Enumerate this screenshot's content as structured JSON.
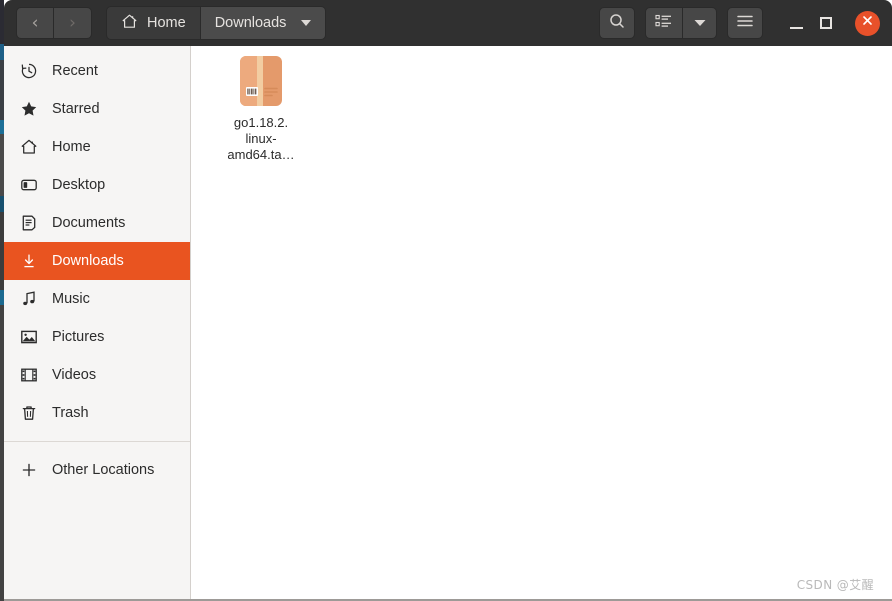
{
  "window": {
    "title": "Downloads",
    "colors": {
      "headerbar": "#303030",
      "sidebar": "#f6f5f4",
      "accent": "#e95420",
      "content": "#ffffff"
    }
  },
  "headerbar": {
    "back_button": {
      "label": "‹",
      "name": "back-button",
      "enabled": true
    },
    "forward_button": {
      "label": "›",
      "name": "forward-button",
      "enabled": false
    },
    "path": [
      {
        "label": "Home",
        "icon": "home-icon",
        "active": false
      },
      {
        "label": "Downloads",
        "icon": "chevron-down-icon",
        "active": true
      }
    ],
    "search_button": {
      "icon": "search-icon",
      "tooltip": "Search"
    },
    "view_button": {
      "icon": "list-view-icon",
      "tooltip": "View options"
    },
    "view_dropdown": {
      "icon": "chevron-down-icon"
    },
    "menu_button": {
      "icon": "hamburger-menu-icon",
      "tooltip": "Main Menu"
    },
    "window_controls": {
      "minimize": "–",
      "maximize": "□",
      "close": "✕"
    }
  },
  "sidebar": {
    "items": [
      {
        "label": "Recent",
        "icon": "clock-icon",
        "selected": false
      },
      {
        "label": "Starred",
        "icon": "star-icon",
        "selected": false
      },
      {
        "label": "Home",
        "icon": "home-icon",
        "selected": false
      },
      {
        "label": "Desktop",
        "icon": "desktop-icon",
        "selected": false
      },
      {
        "label": "Documents",
        "icon": "document-icon",
        "selected": false
      },
      {
        "label": "Downloads",
        "icon": "download-icon",
        "selected": true
      },
      {
        "label": "Music",
        "icon": "music-note-icon",
        "selected": false
      },
      {
        "label": "Pictures",
        "icon": "picture-icon",
        "selected": false
      },
      {
        "label": "Videos",
        "icon": "film-icon",
        "selected": false
      },
      {
        "label": "Trash",
        "icon": "trash-icon",
        "selected": false
      }
    ],
    "other_locations": {
      "label": "Other Locations",
      "icon": "plus-icon"
    }
  },
  "files": [
    {
      "name_line1": "go1.18.2.",
      "name_line2": "linux-",
      "name_line3": "amd64.ta…",
      "icon": "archive-package-icon",
      "icon_color": "#e8a273"
    }
  ],
  "watermark": {
    "text": "CSDN @艾醒"
  }
}
